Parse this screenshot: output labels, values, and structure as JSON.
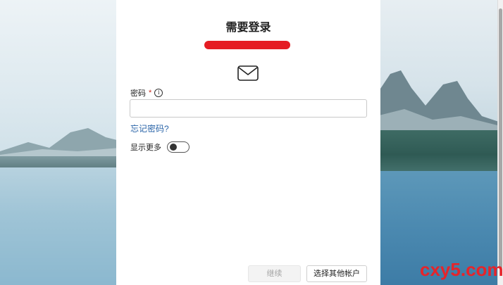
{
  "dialog": {
    "title": "需要登录",
    "password_label": "密码",
    "required_mark": "*",
    "password_value": "",
    "forgot_link": "忘记密码?",
    "show_more_label": "显示更多",
    "show_more_on": false,
    "continue_label": "继续",
    "other_account_label": "选择其他帐户"
  },
  "watermark": {
    "text": "cxy5.com"
  },
  "icons": {
    "mail": "mail-icon",
    "info": "info-icon"
  },
  "colors": {
    "link": "#2a64a8",
    "required": "#c42b1c",
    "redaction": "#e51c23",
    "watermark": "#e6242a"
  }
}
